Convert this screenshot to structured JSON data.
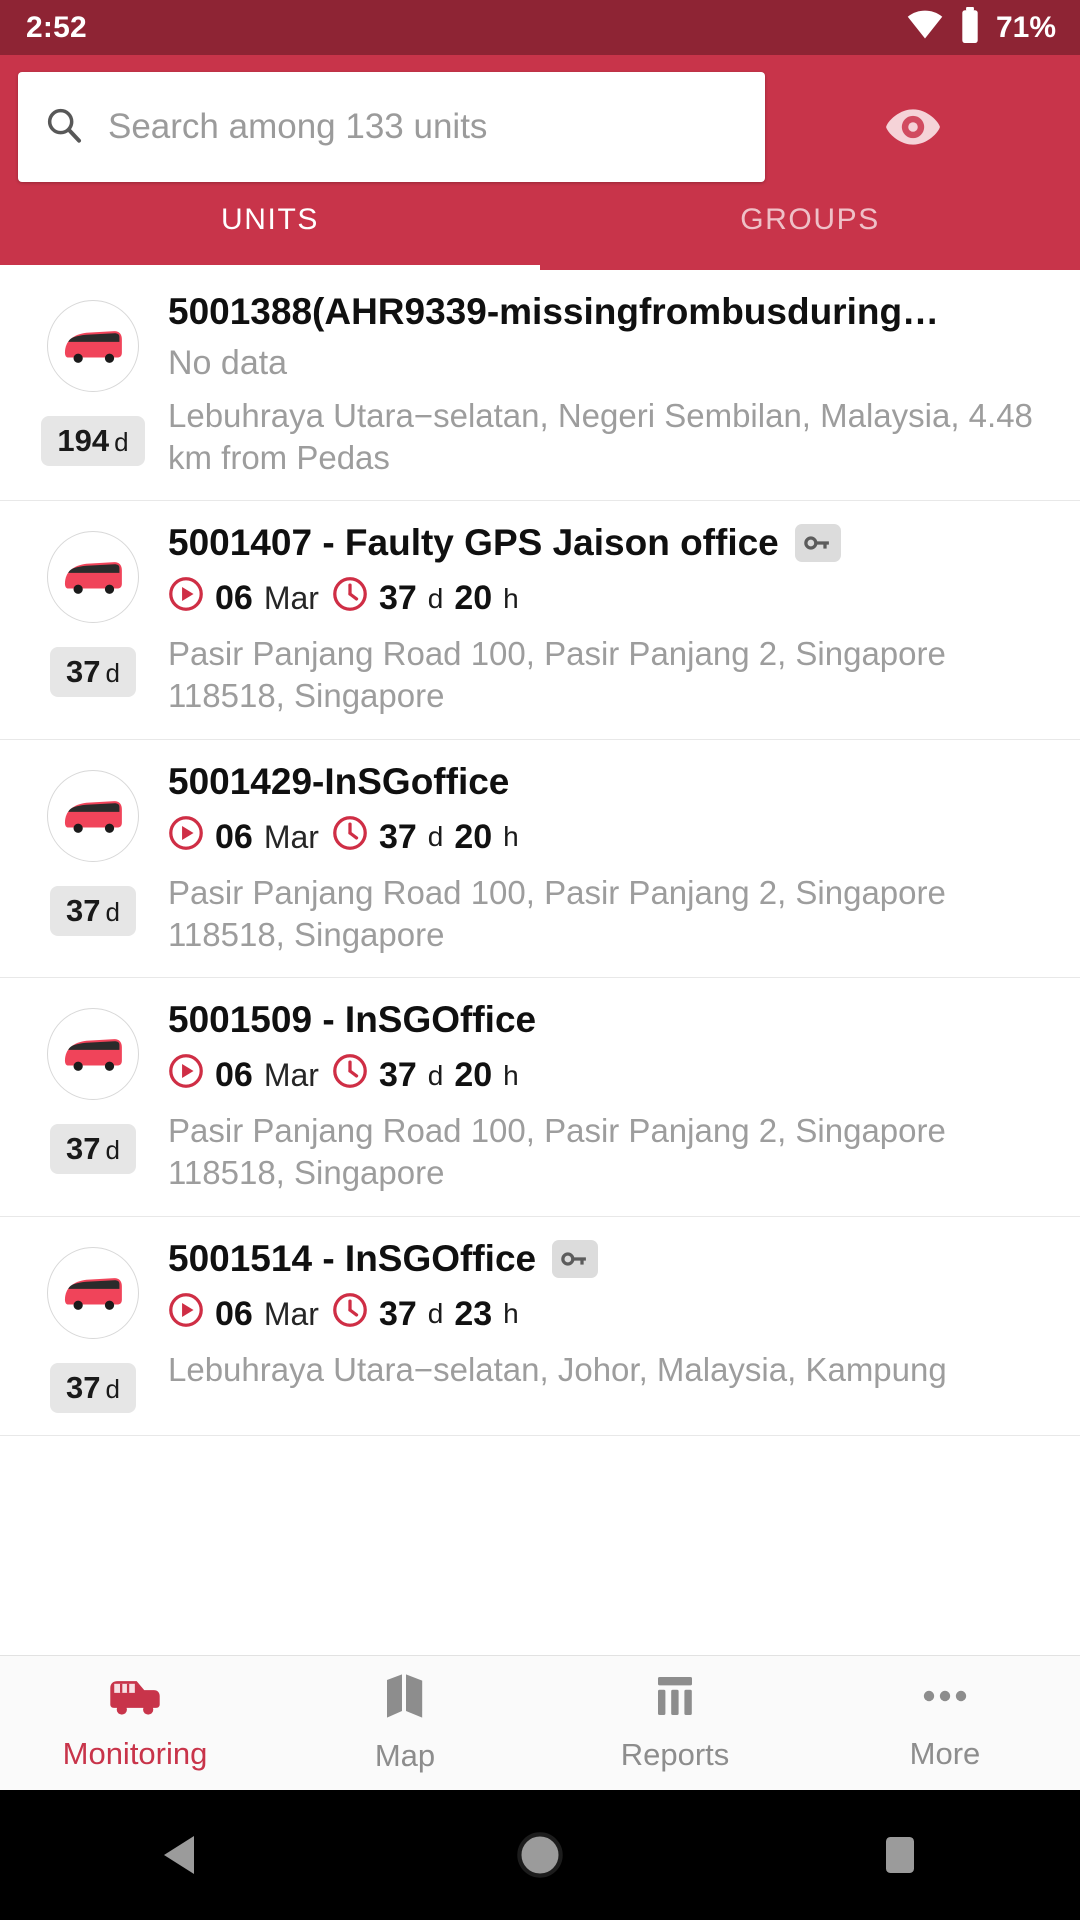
{
  "status_bar": {
    "time": "2:52",
    "battery_percent": "71%",
    "wifi_icon": "wifi-icon",
    "battery_icon": "battery-icon"
  },
  "search": {
    "placeholder": "Search among 133 units",
    "value": "",
    "search_icon": "search-icon",
    "visibility_icon": "eye-icon"
  },
  "tabs": [
    {
      "label": "UNITS",
      "active": true
    },
    {
      "label": "GROUPS",
      "active": false
    }
  ],
  "units": [
    {
      "title": "5001388(AHR9339-missingfrombusduring…",
      "has_key": false,
      "no_data": "No data",
      "date": "",
      "month": "",
      "days": "",
      "hours": "",
      "badge_value": "194",
      "badge_unit": "d",
      "address": "Lebuhraya Utara−selatan, Negeri Sembilan, Malaysia, 4.48 km from Pedas"
    },
    {
      "title": "5001407 - Faulty GPS Jaison office",
      "has_key": true,
      "no_data": "",
      "date": "06",
      "month": "Mar",
      "days": "37",
      "hours": "20",
      "badge_value": "37",
      "badge_unit": "d",
      "address": "Pasir Panjang Road 100, Pasir Panjang 2, Singapore 118518, Singapore"
    },
    {
      "title": "5001429-InSGoffice",
      "has_key": false,
      "no_data": "",
      "date": "06",
      "month": "Mar",
      "days": "37",
      "hours": "20",
      "badge_value": "37",
      "badge_unit": "d",
      "address": "Pasir Panjang Road 100, Pasir Panjang 2, Singapore 118518, Singapore"
    },
    {
      "title": "5001509 - InSGOffice",
      "has_key": false,
      "no_data": "",
      "date": "06",
      "month": "Mar",
      "days": "37",
      "hours": "20",
      "badge_value": "37",
      "badge_unit": "d",
      "address": "Pasir Panjang Road 100, Pasir Panjang 2, Singapore 118518, Singapore"
    },
    {
      "title": "5001514 - InSGOffice",
      "has_key": true,
      "no_data": "",
      "date": "06",
      "month": "Mar",
      "days": "37",
      "hours": "23",
      "badge_value": "37",
      "badge_unit": "d",
      "address": "Lebuhraya Utara−selatan, Johor, Malaysia, Kampung"
    }
  ],
  "meta_labels": {
    "days_suffix": "d",
    "hours_suffix": "h",
    "play_icon": "play-circle-icon",
    "clock_icon": "clock-icon",
    "key_icon": "key-icon",
    "avatar_icon": "bus-icon"
  },
  "bottom_nav": [
    {
      "label": "Monitoring",
      "icon": "bus-front-icon",
      "active": true
    },
    {
      "label": "Map",
      "icon": "map-icon",
      "active": false
    },
    {
      "label": "Reports",
      "icon": "reports-bars-icon",
      "active": false
    },
    {
      "label": "More",
      "icon": "more-dots-icon",
      "active": false
    }
  ],
  "android_nav": [
    {
      "icon": "back-triangle-icon"
    },
    {
      "icon": "home-circle-icon"
    },
    {
      "icon": "recents-square-icon"
    }
  ],
  "colors": {
    "status_bar": "#8E2434",
    "app_bar": "#C8344A",
    "accent": "#C8344A",
    "muted_text": "#9d9d9d",
    "badge_bg": "#e6e6e6"
  }
}
